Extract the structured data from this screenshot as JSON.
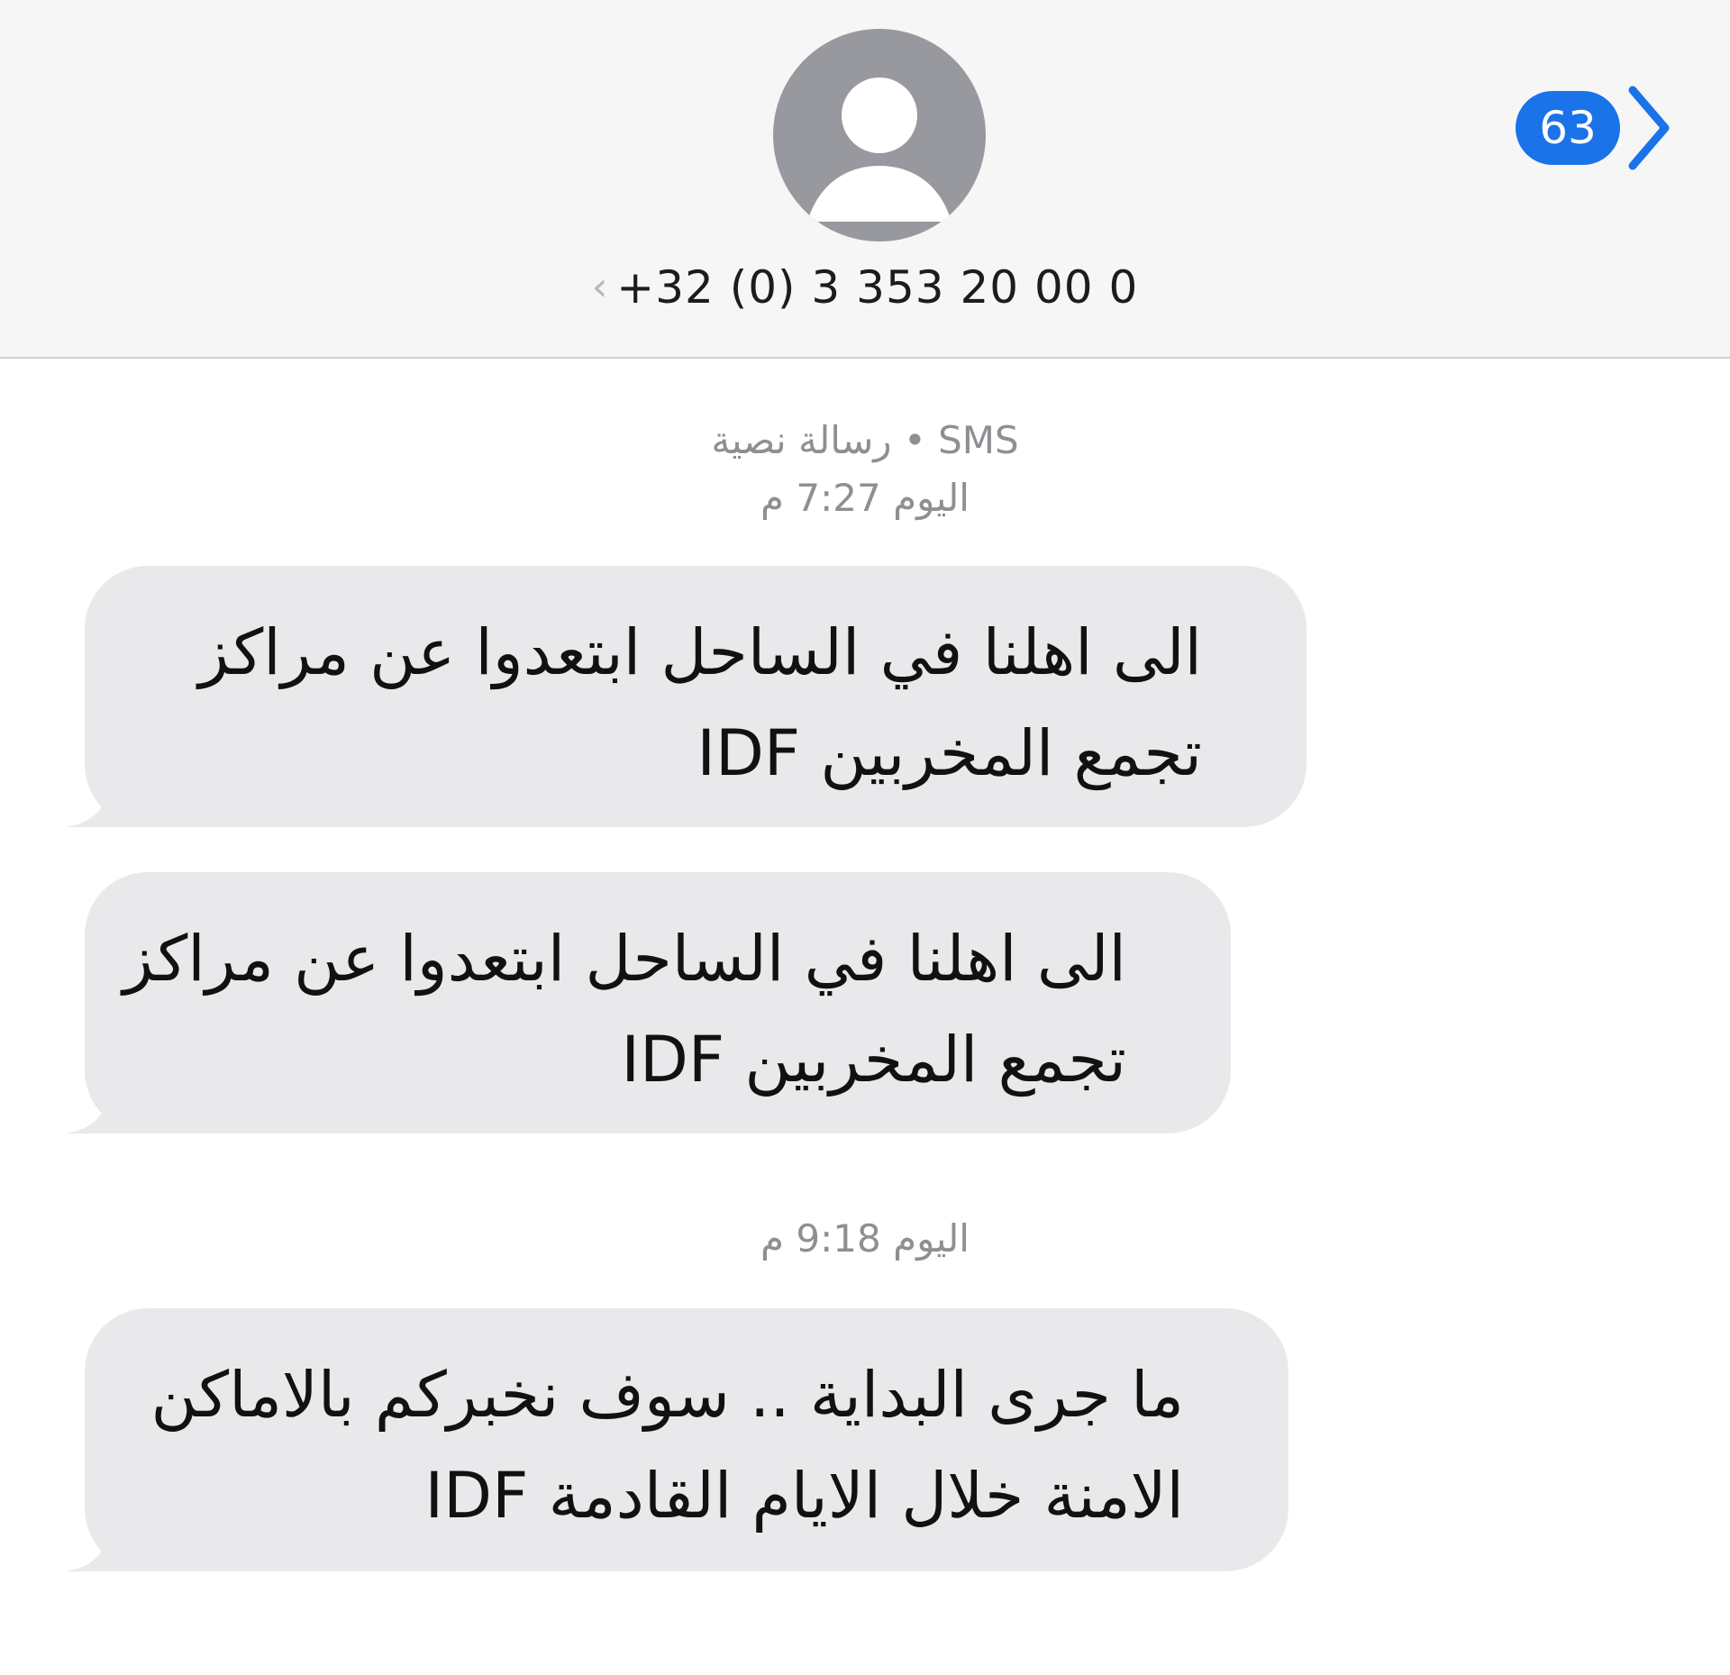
{
  "header": {
    "avatar_icon": "person-silhouette-icon",
    "contact_number": "+32 (0) 3 353 20 00 0",
    "contact_chevron": "‹",
    "unread_count": "63",
    "back_icon": "chevron-left-icon",
    "accent_color": "#1a73e8"
  },
  "conversation": {
    "meta_1_type": "رسالة نصية • SMS",
    "meta_1_time": "اليوم 7:27 م",
    "meta_2_time": "اليوم 9:18 م",
    "messages": [
      {
        "lines": [
          "الى اهلنا في الساحل ابتعدوا عن مراكز",
          "تجمع المخربين IDF"
        ]
      },
      {
        "lines": [
          "الى اهلنا في الساحل ابتعدوا عن مراكز",
          "تجمع المخربين IDF"
        ]
      },
      {
        "lines": [
          "ما جرى البداية .. سوف نخبركم بالاماكن",
          "الامنة خلال الايام القادمة IDF"
        ]
      }
    ],
    "bubble_color": "#e9e9eb"
  }
}
